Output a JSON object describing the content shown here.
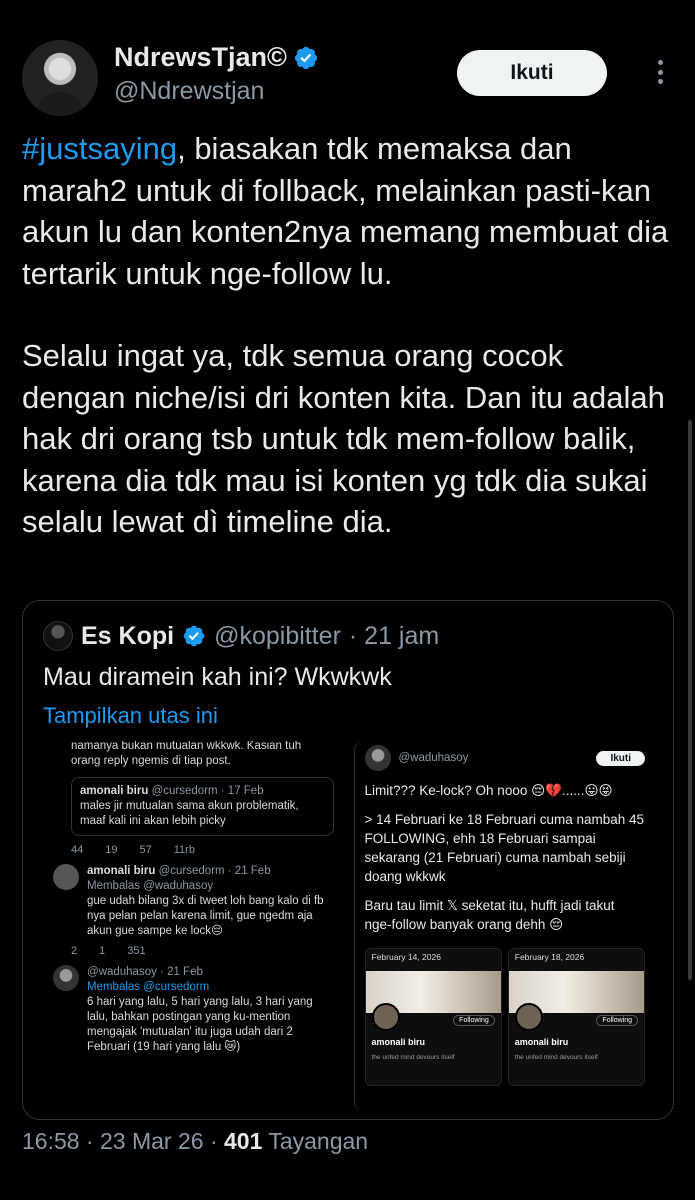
{
  "author": {
    "display_name": "NdrewsTjan©",
    "handle": "@Ndrewstjan",
    "follow_label": "Ikuti"
  },
  "tweet": {
    "hashtag": "#justsaying",
    "para1_rest": ", biasakan tdk memaksa dan marah2 untuk di follback, melainkan pasti-kan akun lu dan konten2nya memang membuat dia tertarik untuk nge-follow lu.",
    "para2": "Selalu ingat ya, tdk semua orang cocok dengan niche/isi dri konten kita. Dan itu adalah hak dri orang tsb untuk tdk mem-follow balik, karena dia tdk mau isi konten yg tdk dia sukai selalu lewat dì timeline dia."
  },
  "quote": {
    "name": "Es Kopi",
    "handle": "@kopibitter",
    "time": "· 21 jam",
    "text": "Mau diramein kah ini? Wkwkwk",
    "show_thread": "Tampilkan utas ini",
    "left_shot": {
      "top_text": "namanya bukan mutualan wkkwk. Kasian tuh orang reply ngemis di tiap post.",
      "nested_name": "amonali biru",
      "nested_handle": "@cursedorm · 17 Feb",
      "nested_text": "males jir mutualan sama akun problematik, maaf kali ini akan lebih picky",
      "actions1": [
        "44",
        "19",
        "57",
        "11rb"
      ],
      "reply1_name": "amonali biru",
      "reply1_handle": "@cursedorm · 21 Feb",
      "reply1_to": "Membalas @waduhasoy",
      "reply1_text": "gue udah bilang 3x di tweet loh bang kalo di fb nya pelan pelan karena limit, gue ngedm aja akun gue sampe ke lock😔",
      "actions2": [
        "2",
        "1",
        "351"
      ],
      "reply2_handle": "@waduhasoy · 21 Feb",
      "reply2_to": "Membalas @cursedorm",
      "reply2_text": "6 hari yang lalu, 5 hari yang lalu, 3 hari yang lalu, bahkan postingan yang ku-mention mengajak 'mutualan' itu juga udah dari 2 Februari (19 hari yang lalu 😿)"
    },
    "right_shot": {
      "handle": "@waduhasoy",
      "follow_label": "Ikuti",
      "line1": "Limit??? Ke-lock? Oh nooo 😔💔......😛😝",
      "line2": "> 14 Februari ke 18 Februari cuma nambah 45 FOLLOWING, ehh 18 Februari sampai sekarang (21 Februari) cuma nambah sebiji doang wkkwk",
      "line3": "Baru tau limit 𝕏 seketat itu, hufft jadi takut nge-follow banyak orang dehh 😔",
      "mini1_date": "February 14, 2026",
      "mini2_date": "February 18, 2026",
      "mini_button": "Following",
      "mini_name": "amonali biru",
      "mini_meta": "the unfed mind devours itself"
    }
  },
  "footer": {
    "time": "16:58 · 23 Mar 26 · ",
    "views": "401",
    "views_label": " Tayangan"
  }
}
